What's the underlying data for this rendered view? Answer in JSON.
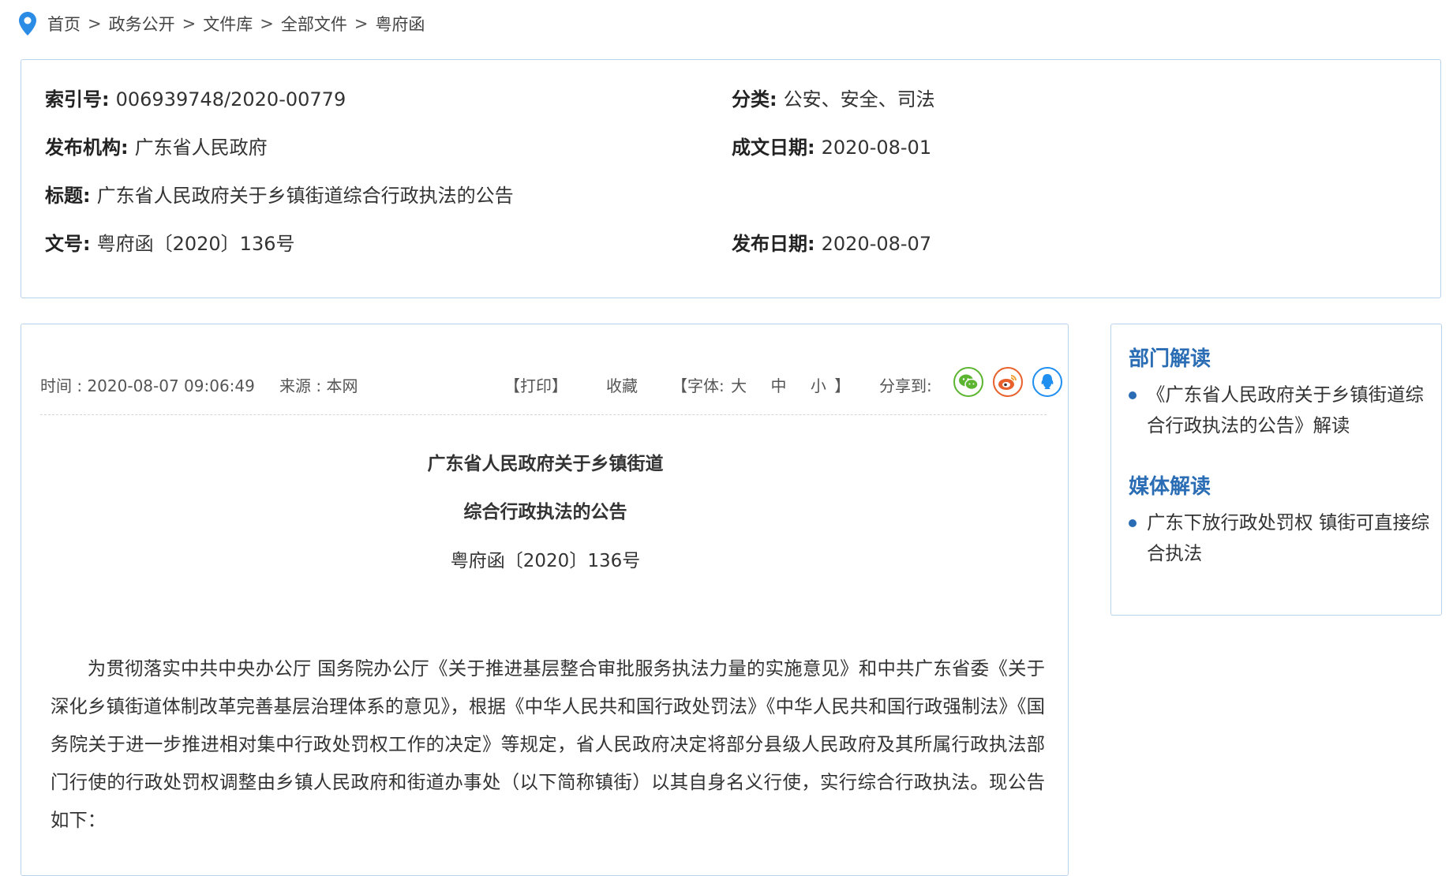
{
  "breadcrumb": {
    "items": [
      "首页",
      "政务公开",
      "文件库",
      "全部文件",
      "粤府函"
    ],
    "separator": ">"
  },
  "meta": {
    "index_label": "索引号:",
    "index_value": "006939748/2020-00779",
    "category_label": "分类:",
    "category_value": "公安、安全、司法",
    "publisher_label": "发布机构:",
    "publisher_value": "广东省人民政府",
    "written_date_label": "成文日期:",
    "written_date_value": "2020-08-01",
    "title_label": "标题:",
    "title_value": "广东省人民政府关于乡镇街道综合行政执法的公告",
    "doc_no_label": "文号:",
    "doc_no_value": "粤府函〔2020〕136号",
    "publish_date_label": "发布日期:",
    "publish_date_value": "2020-08-07"
  },
  "toolbar": {
    "time": "时间 : 2020-08-07 09:06:49",
    "source": "来源 : 本网",
    "print": "【打印】",
    "favorite": "收藏",
    "font_prefix": "【字体:",
    "font_large": "大",
    "font_medium": "中",
    "font_small": "小",
    "font_suffix": "】",
    "share_label": "分享到:"
  },
  "document": {
    "title_line1": "广东省人民政府关于乡镇街道",
    "title_line2": "综合行政执法的公告",
    "number": "粤府函〔2020〕136号",
    "body": "为贯彻落实中共中央办公厅 国务院办公厅《关于推进基层整合审批服务执法力量的实施意见》和中共广东省委《关于深化乡镇街道体制改革完善基层治理体系的意见》，根据《中华人民共和国行政处罚法》《中华人民共和国行政强制法》《国务院关于进一步推进相对集中行政处罚权工作的决定》等规定，省人民政府决定将部分县级人民政府及其所属行政执法部门行使的行政处罚权调整由乡镇人民政府和街道办事处（以下简称镇街）以其自身名义行使，实行综合行政执法。现公告如下："
  },
  "sidebar": {
    "dept_heading": "部门解读",
    "dept_items": [
      "《广东省人民政府关于乡镇街道综合行政执法的公告》解读"
    ],
    "media_heading": "媒体解读",
    "media_items": [
      "广东下放行政处罚权 镇街可直接综合执法"
    ]
  },
  "colors": {
    "accent": "#2b6db4",
    "border": "#b9d3ec",
    "wechat": "#5cb531",
    "weibo": "#e8612c",
    "qq": "#1f8ff0"
  }
}
